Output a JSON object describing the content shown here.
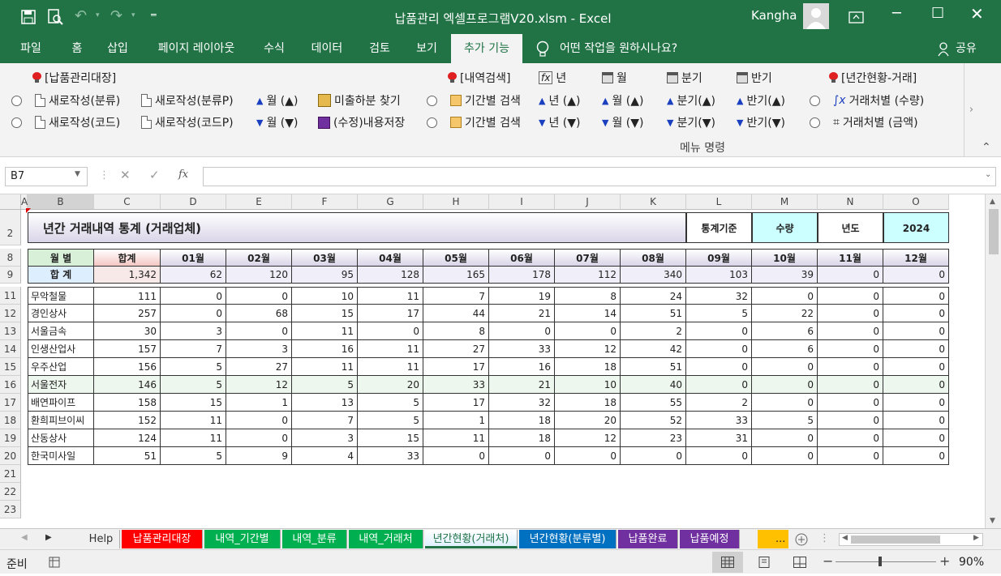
{
  "window": {
    "title": "납품관리 엑셀프로그램V20.xlsm  -  Excel",
    "user": "Kangha"
  },
  "ribbon_tabs": [
    "파일",
    "홈",
    "삽입",
    "페이지 레이아웃",
    "수식",
    "데이터",
    "검토",
    "보기",
    "추가 기능"
  ],
  "tell_me": "어떤 작업을 원하시나요?",
  "share": "공유",
  "ribbon": {
    "g1_title": "[납품관리대장]",
    "new_cat": "새로작성(분류)",
    "new_catP": "새로작성(분류P)",
    "new_code": "새로작성(코드)",
    "new_codeP": "새로작성(코드P)",
    "month_up": "월 (▲)",
    "month_down": "월 (▼)",
    "find_unshipped": "미출하분 찾기",
    "save_edit": "(수정)내용저장",
    "g2_title": "[내역검색]",
    "period_search1": "기간별 검색",
    "period_search2": "기간별 검색",
    "year": "년",
    "year_up": "년 (▲)",
    "year_down": "년 (▼)",
    "month": "월",
    "month2_up": "월 (▲)",
    "month2_down": "월 (▼)",
    "quarter": "분기",
    "quarter_up": "분기(▲)",
    "quarter_down": "분기(▼)",
    "half": "반기",
    "half_up": "반기(▲)",
    "half_down": "반기(▼)",
    "g3_title": "[년간현황-거래]",
    "by_client_qty": "거래처별 (수량)",
    "by_client_amt": "거래처별 (금액)",
    "group_label": "메뉴 명령"
  },
  "namebox": "B7",
  "fx": "fx",
  "columns": [
    "A",
    "B",
    "C",
    "D",
    "E",
    "F",
    "G",
    "H",
    "I",
    "J",
    "K",
    "L",
    "M",
    "N",
    "O"
  ],
  "rows": [
    "2",
    "8",
    "9",
    "11",
    "12",
    "13",
    "14",
    "15",
    "16",
    "17",
    "18",
    "19",
    "20",
    "21",
    "22",
    "23"
  ],
  "sheet": {
    "title": "년간 거래내역 통계 (거래업체)",
    "basis_label": "통계기준",
    "basis_value": "수량",
    "year_label": "년도",
    "year_value": "2024",
    "month_header": "월    별",
    "total_header": "합계",
    "months": [
      "01월",
      "02월",
      "03월",
      "04월",
      "05월",
      "06월",
      "07월",
      "08월",
      "09월",
      "10월",
      "11월",
      "12월"
    ],
    "sum_label": "합    계",
    "sum_total": "1,342",
    "sum_values": [
      "62",
      "120",
      "95",
      "128",
      "165",
      "178",
      "112",
      "340",
      "103",
      "39",
      "0",
      "0"
    ],
    "companies": [
      {
        "name": "무악철물",
        "total": "111",
        "values": [
          "0",
          "0",
          "10",
          "11",
          "7",
          "19",
          "8",
          "24",
          "32",
          "0",
          "0",
          "0"
        ]
      },
      {
        "name": "경인상사",
        "total": "257",
        "values": [
          "0",
          "68",
          "15",
          "17",
          "44",
          "21",
          "14",
          "51",
          "5",
          "22",
          "0",
          "0"
        ]
      },
      {
        "name": "서울금속",
        "total": "30",
        "values": [
          "3",
          "0",
          "11",
          "0",
          "8",
          "0",
          "0",
          "2",
          "0",
          "6",
          "0",
          "0"
        ]
      },
      {
        "name": "인생산업사",
        "total": "157",
        "values": [
          "7",
          "3",
          "16",
          "11",
          "27",
          "33",
          "12",
          "42",
          "0",
          "6",
          "0",
          "0"
        ]
      },
      {
        "name": "우주산업",
        "total": "156",
        "values": [
          "5",
          "27",
          "11",
          "11",
          "17",
          "16",
          "18",
          "51",
          "0",
          "0",
          "0",
          "0"
        ]
      },
      {
        "name": "서울전자",
        "total": "146",
        "values": [
          "5",
          "12",
          "5",
          "20",
          "33",
          "21",
          "10",
          "40",
          "0",
          "0",
          "0",
          "0"
        ]
      },
      {
        "name": "배연파이프",
        "total": "158",
        "values": [
          "15",
          "1",
          "13",
          "5",
          "17",
          "32",
          "18",
          "55",
          "2",
          "0",
          "0",
          "0"
        ]
      },
      {
        "name": "환희피브이씨",
        "total": "152",
        "values": [
          "11",
          "0",
          "7",
          "5",
          "1",
          "18",
          "20",
          "52",
          "33",
          "5",
          "0",
          "0"
        ]
      },
      {
        "name": "산동상사",
        "total": "124",
        "values": [
          "11",
          "0",
          "3",
          "15",
          "11",
          "18",
          "12",
          "23",
          "31",
          "0",
          "0",
          "0"
        ]
      },
      {
        "name": "한국미사일",
        "total": "51",
        "values": [
          "5",
          "9",
          "4",
          "33",
          "0",
          "0",
          "0",
          "0",
          "0",
          "0",
          "0",
          "0"
        ]
      }
    ]
  },
  "sheet_tabs": [
    {
      "label": "Help",
      "color": "#f0f0f0",
      "fg": "#333"
    },
    {
      "label": "납품관리대장",
      "color": "#ff0000",
      "fg": "#fff"
    },
    {
      "label": "내역_기간별",
      "color": "#00b050",
      "fg": "#fff"
    },
    {
      "label": "내역_분류",
      "color": "#00b050",
      "fg": "#fff"
    },
    {
      "label": "내역_거래처",
      "color": "#00b050",
      "fg": "#fff"
    },
    {
      "label": "년간현황(거래처)",
      "color": "#ffffff",
      "fg": "#217346"
    },
    {
      "label": "년간현황(분류별)",
      "color": "#0070c0",
      "fg": "#fff"
    },
    {
      "label": "납품완료",
      "color": "#7030a0",
      "fg": "#fff"
    },
    {
      "label": "납품예정",
      "color": "#7030a0",
      "fg": "#fff"
    }
  ],
  "sheet_more": "...",
  "status": {
    "ready": "준비",
    "zoom": "90%"
  }
}
